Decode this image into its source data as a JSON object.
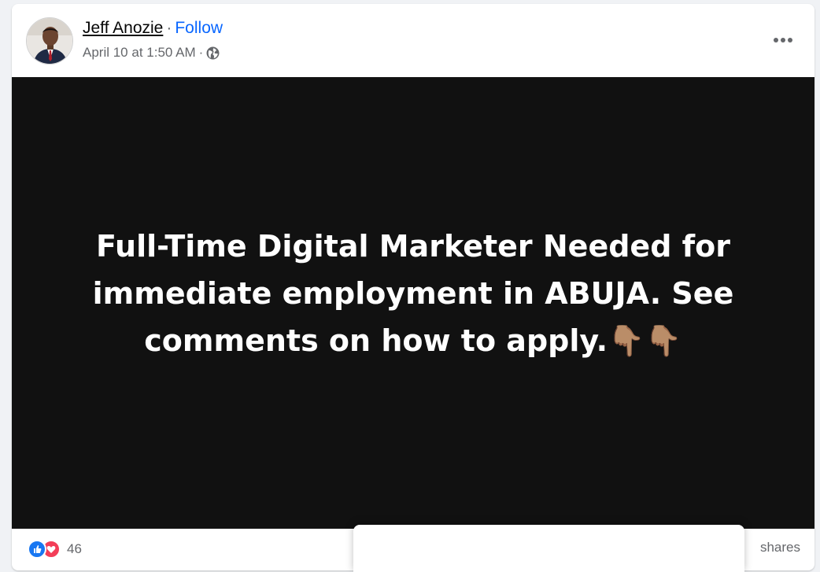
{
  "post": {
    "author": {
      "name": "Jeff Anozie",
      "avatar_icon": "person-avatar"
    },
    "separator": "·",
    "follow_label": "Follow",
    "timestamp": "April 10 at 1:50 AM",
    "meta_separator": "·",
    "privacy_icon": "globe-icon",
    "more_icon": "more-horizontal-icon",
    "media_text": "Full-Time Digital Marketer Needed for immediate employment in ABUJA. See comments on how to apply.👇🏽👇🏽",
    "reactions": {
      "icons": [
        "like-icon",
        "love-icon"
      ],
      "count": "46"
    },
    "shares_label": "shares"
  },
  "colors": {
    "link_blue": "#0866ff",
    "secondary_text": "#65676b",
    "media_bg": "#111111",
    "like_blue": "#1877f2",
    "love_red": "#f33e58"
  }
}
